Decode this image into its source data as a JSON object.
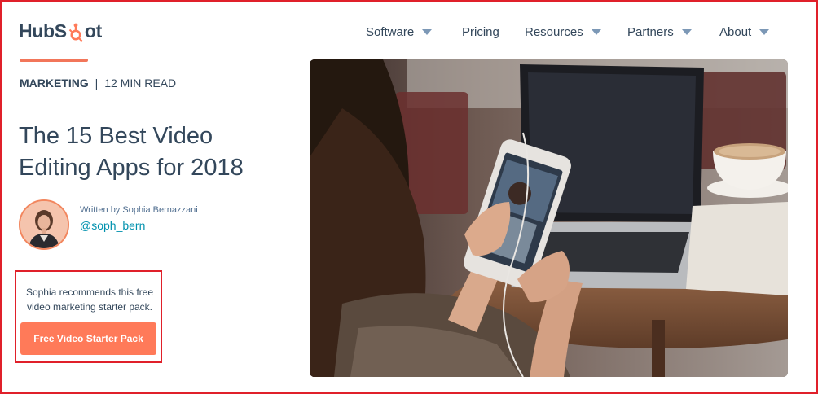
{
  "brand": {
    "logo_left": "HubS",
    "logo_right": "ot",
    "accent": "#ff7a59"
  },
  "nav": {
    "items": [
      {
        "label": "Software",
        "has_caret": true
      },
      {
        "label": "Pricing",
        "has_caret": false
      },
      {
        "label": "Resources",
        "has_caret": true
      },
      {
        "label": "Partners",
        "has_caret": true
      },
      {
        "label": "About",
        "has_caret": true
      }
    ]
  },
  "article": {
    "category": "MARKETING",
    "separator": "|",
    "read_time": "12 MIN READ",
    "title": "The 15 Best Video Editing Apps for 2018",
    "author_line": "Written by Sophia Bernazzani",
    "author_handle": "@soph_bern"
  },
  "promo": {
    "text": "Sophia recommends this free video marketing starter pack.",
    "button_label": "Free Video Starter Pack"
  },
  "hero_image": {
    "icon": "photo-woman-phone-laptop"
  }
}
